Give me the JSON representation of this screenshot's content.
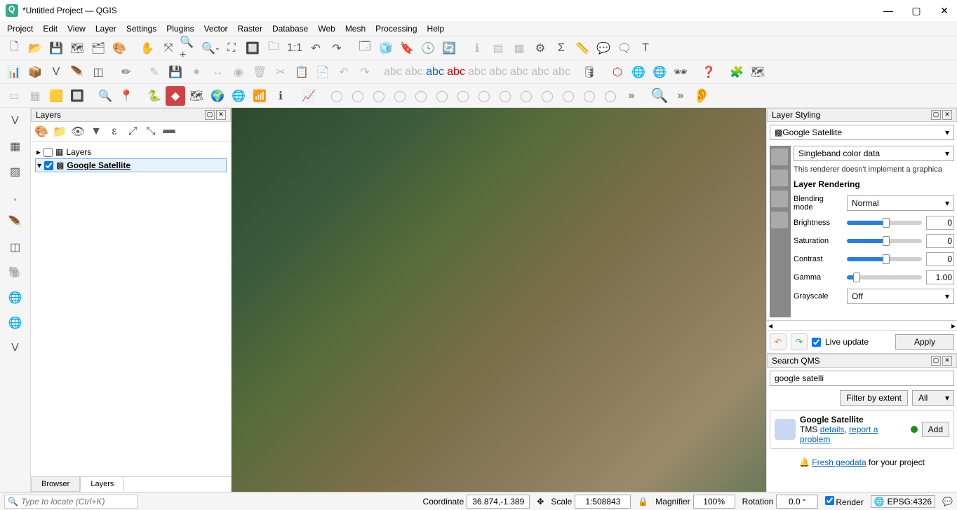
{
  "titlebar": {
    "title": "*Untitled Project — QGIS"
  },
  "menu": {
    "items": [
      "Project",
      "Edit",
      "View",
      "Layer",
      "Settings",
      "Plugins",
      "Vector",
      "Raster",
      "Database",
      "Web",
      "Mesh",
      "Processing",
      "Help"
    ]
  },
  "layers_panel": {
    "title": "Layers",
    "items": [
      {
        "label": "Layers",
        "checked": false,
        "expandable": true,
        "selected": false
      },
      {
        "label": "Google Satellite",
        "checked": true,
        "expandable": true,
        "selected": true
      }
    ],
    "tabs": [
      "Browser",
      "Layers"
    ],
    "active_tab": "Layers"
  },
  "styling": {
    "title": "Layer Styling",
    "layer_select": "Google Satellite",
    "render_type": "Singleband color data",
    "note": "This renderer doesn't implement a graphica",
    "section": "Layer Rendering",
    "blending_label": "Blending mode",
    "blending_value": "Normal",
    "sliders": {
      "brightness": {
        "label": "Brightness",
        "value": "0"
      },
      "saturation": {
        "label": "Saturation",
        "value": "0"
      },
      "contrast": {
        "label": "Contrast",
        "value": "0"
      },
      "gamma": {
        "label": "Gamma",
        "value": "1.00"
      }
    },
    "grayscale_label": "Grayscale",
    "grayscale_value": "Off",
    "live_update": "Live update",
    "apply": "Apply"
  },
  "search_qms": {
    "title": "Search QMS",
    "query": "google satelli",
    "filter_extent": "Filter by extent",
    "filter_all": "All",
    "result": {
      "title": "Google Satellite",
      "type": "TMS",
      "details": "details",
      "report": "report a problem",
      "add": "Add"
    },
    "fresh_prefix": "🔔 ",
    "fresh_link": "Fresh geodata",
    "fresh_suffix": " for your project"
  },
  "status": {
    "locator_placeholder": "Type to locate (Ctrl+K)",
    "coord_label": "Coordinate",
    "coord_value": "36.874,-1.389",
    "scale_label": "Scale",
    "scale_value": "1:508843",
    "magnifier_label": "Magnifier",
    "magnifier_value": "100%",
    "rotation_label": "Rotation",
    "rotation_value": "0.0 °",
    "render_label": "Render",
    "epsg": "EPSG:4326"
  }
}
